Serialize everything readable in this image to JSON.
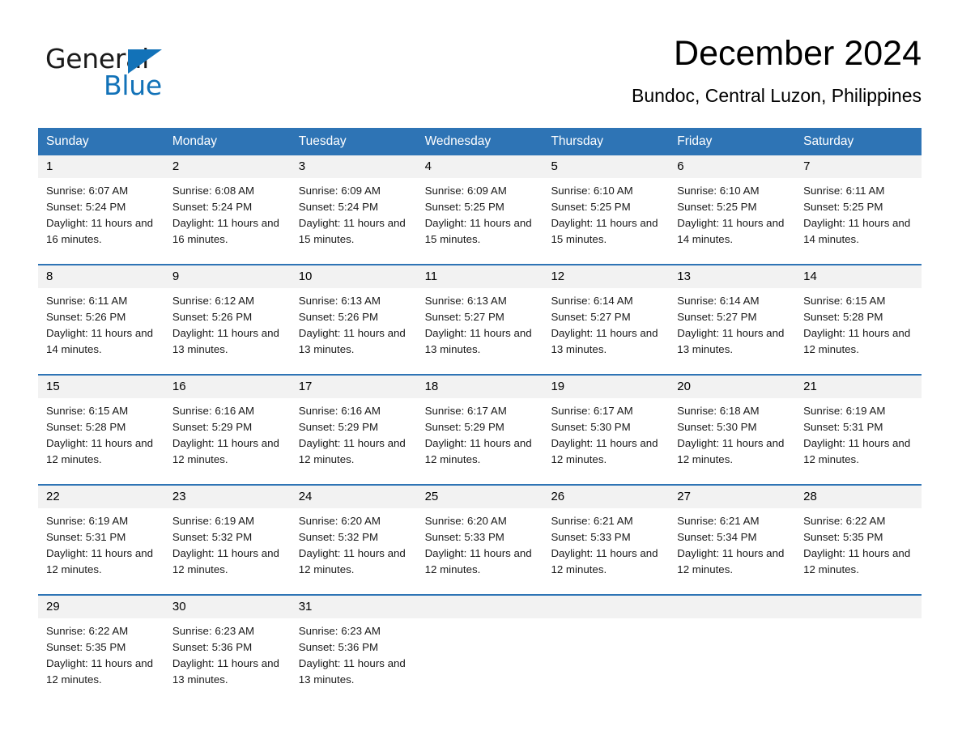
{
  "logo": {
    "word_general": "General",
    "word_blue": "Blue",
    "triangle_color": "#1272b8"
  },
  "header": {
    "title": "December 2024",
    "subtitle": "Bundoc, Central Luzon, Philippines"
  },
  "theme": {
    "header_blue": "#2e74b5",
    "day_band_gray": "#f2f2f2",
    "text_black": "#000000"
  },
  "calendar": {
    "weekday_headers": [
      "Sunday",
      "Monday",
      "Tuesday",
      "Wednesday",
      "Thursday",
      "Friday",
      "Saturday"
    ],
    "weeks": [
      [
        {
          "day": "1",
          "sunrise": "Sunrise: 6:07 AM",
          "sunset": "Sunset: 5:24 PM",
          "daylight": "Daylight: 11 hours and 16 minutes."
        },
        {
          "day": "2",
          "sunrise": "Sunrise: 6:08 AM",
          "sunset": "Sunset: 5:24 PM",
          "daylight": "Daylight: 11 hours and 16 minutes."
        },
        {
          "day": "3",
          "sunrise": "Sunrise: 6:09 AM",
          "sunset": "Sunset: 5:24 PM",
          "daylight": "Daylight: 11 hours and 15 minutes."
        },
        {
          "day": "4",
          "sunrise": "Sunrise: 6:09 AM",
          "sunset": "Sunset: 5:25 PM",
          "daylight": "Daylight: 11 hours and 15 minutes."
        },
        {
          "day": "5",
          "sunrise": "Sunrise: 6:10 AM",
          "sunset": "Sunset: 5:25 PM",
          "daylight": "Daylight: 11 hours and 15 minutes."
        },
        {
          "day": "6",
          "sunrise": "Sunrise: 6:10 AM",
          "sunset": "Sunset: 5:25 PM",
          "daylight": "Daylight: 11 hours and 14 minutes."
        },
        {
          "day": "7",
          "sunrise": "Sunrise: 6:11 AM",
          "sunset": "Sunset: 5:25 PM",
          "daylight": "Daylight: 11 hours and 14 minutes."
        }
      ],
      [
        {
          "day": "8",
          "sunrise": "Sunrise: 6:11 AM",
          "sunset": "Sunset: 5:26 PM",
          "daylight": "Daylight: 11 hours and 14 minutes."
        },
        {
          "day": "9",
          "sunrise": "Sunrise: 6:12 AM",
          "sunset": "Sunset: 5:26 PM",
          "daylight": "Daylight: 11 hours and 13 minutes."
        },
        {
          "day": "10",
          "sunrise": "Sunrise: 6:13 AM",
          "sunset": "Sunset: 5:26 PM",
          "daylight": "Daylight: 11 hours and 13 minutes."
        },
        {
          "day": "11",
          "sunrise": "Sunrise: 6:13 AM",
          "sunset": "Sunset: 5:27 PM",
          "daylight": "Daylight: 11 hours and 13 minutes."
        },
        {
          "day": "12",
          "sunrise": "Sunrise: 6:14 AM",
          "sunset": "Sunset: 5:27 PM",
          "daylight": "Daylight: 11 hours and 13 minutes."
        },
        {
          "day": "13",
          "sunrise": "Sunrise: 6:14 AM",
          "sunset": "Sunset: 5:27 PM",
          "daylight": "Daylight: 11 hours and 13 minutes."
        },
        {
          "day": "14",
          "sunrise": "Sunrise: 6:15 AM",
          "sunset": "Sunset: 5:28 PM",
          "daylight": "Daylight: 11 hours and 12 minutes."
        }
      ],
      [
        {
          "day": "15",
          "sunrise": "Sunrise: 6:15 AM",
          "sunset": "Sunset: 5:28 PM",
          "daylight": "Daylight: 11 hours and 12 minutes."
        },
        {
          "day": "16",
          "sunrise": "Sunrise: 6:16 AM",
          "sunset": "Sunset: 5:29 PM",
          "daylight": "Daylight: 11 hours and 12 minutes."
        },
        {
          "day": "17",
          "sunrise": "Sunrise: 6:16 AM",
          "sunset": "Sunset: 5:29 PM",
          "daylight": "Daylight: 11 hours and 12 minutes."
        },
        {
          "day": "18",
          "sunrise": "Sunrise: 6:17 AM",
          "sunset": "Sunset: 5:29 PM",
          "daylight": "Daylight: 11 hours and 12 minutes."
        },
        {
          "day": "19",
          "sunrise": "Sunrise: 6:17 AM",
          "sunset": "Sunset: 5:30 PM",
          "daylight": "Daylight: 11 hours and 12 minutes."
        },
        {
          "day": "20",
          "sunrise": "Sunrise: 6:18 AM",
          "sunset": "Sunset: 5:30 PM",
          "daylight": "Daylight: 11 hours and 12 minutes."
        },
        {
          "day": "21",
          "sunrise": "Sunrise: 6:19 AM",
          "sunset": "Sunset: 5:31 PM",
          "daylight": "Daylight: 11 hours and 12 minutes."
        }
      ],
      [
        {
          "day": "22",
          "sunrise": "Sunrise: 6:19 AM",
          "sunset": "Sunset: 5:31 PM",
          "daylight": "Daylight: 11 hours and 12 minutes."
        },
        {
          "day": "23",
          "sunrise": "Sunrise: 6:19 AM",
          "sunset": "Sunset: 5:32 PM",
          "daylight": "Daylight: 11 hours and 12 minutes."
        },
        {
          "day": "24",
          "sunrise": "Sunrise: 6:20 AM",
          "sunset": "Sunset: 5:32 PM",
          "daylight": "Daylight: 11 hours and 12 minutes."
        },
        {
          "day": "25",
          "sunrise": "Sunrise: 6:20 AM",
          "sunset": "Sunset: 5:33 PM",
          "daylight": "Daylight: 11 hours and 12 minutes."
        },
        {
          "day": "26",
          "sunrise": "Sunrise: 6:21 AM",
          "sunset": "Sunset: 5:33 PM",
          "daylight": "Daylight: 11 hours and 12 minutes."
        },
        {
          "day": "27",
          "sunrise": "Sunrise: 6:21 AM",
          "sunset": "Sunset: 5:34 PM",
          "daylight": "Daylight: 11 hours and 12 minutes."
        },
        {
          "day": "28",
          "sunrise": "Sunrise: 6:22 AM",
          "sunset": "Sunset: 5:35 PM",
          "daylight": "Daylight: 11 hours and 12 minutes."
        }
      ],
      [
        {
          "day": "29",
          "sunrise": "Sunrise: 6:22 AM",
          "sunset": "Sunset: 5:35 PM",
          "daylight": "Daylight: 11 hours and 12 minutes."
        },
        {
          "day": "30",
          "sunrise": "Sunrise: 6:23 AM",
          "sunset": "Sunset: 5:36 PM",
          "daylight": "Daylight: 11 hours and 13 minutes."
        },
        {
          "day": "31",
          "sunrise": "Sunrise: 6:23 AM",
          "sunset": "Sunset: 5:36 PM",
          "daylight": "Daylight: 11 hours and 13 minutes."
        },
        {
          "day": "",
          "sunrise": "",
          "sunset": "",
          "daylight": ""
        },
        {
          "day": "",
          "sunrise": "",
          "sunset": "",
          "daylight": ""
        },
        {
          "day": "",
          "sunrise": "",
          "sunset": "",
          "daylight": ""
        },
        {
          "day": "",
          "sunrise": "",
          "sunset": "",
          "daylight": ""
        }
      ]
    ]
  }
}
